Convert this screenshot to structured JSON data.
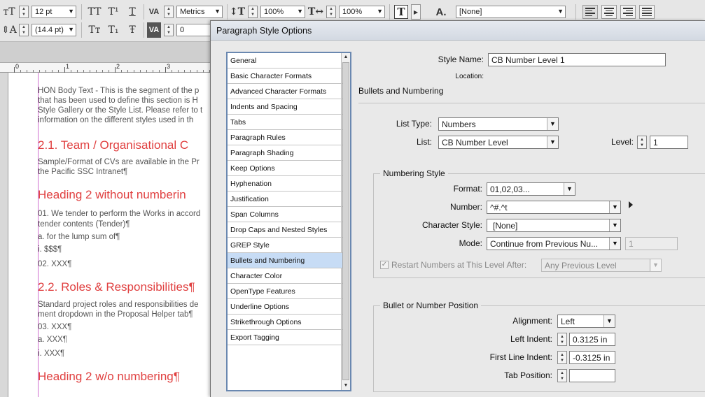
{
  "toolbar": {
    "font_size": "12 pt",
    "leading": "(14.4 pt)",
    "kerning": "Metrics",
    "tracking": "0",
    "vertical_scale": "100%",
    "horizontal_scale": "100%",
    "language": "[None]",
    "icon_all_caps": "TT",
    "icon_superscript": "T¹",
    "icon_underline": "T",
    "icon_small_caps": "Tт",
    "icon_subscript": "T₁",
    "icon_strikethrough": "Ŧ",
    "icon_char_style": "A."
  },
  "ruler": {
    "labels": [
      "0",
      "1",
      "2",
      "3"
    ]
  },
  "document": {
    "lines": [
      {
        "cls": "body-t",
        "text": "HON Body Text - This is the segment of the p"
      },
      {
        "cls": "body-t",
        "text": "that has been used to define this section is H"
      },
      {
        "cls": "body-t",
        "text": "Style Gallery or the Style List. Please refer to t"
      },
      {
        "cls": "body-t",
        "text": "information on the different styles used in th"
      },
      {
        "cls": "h2",
        "text": "2.1. Team / Organisational C"
      },
      {
        "cls": "body-t",
        "text": "Sample/Format of CVs are available in the Pr"
      },
      {
        "cls": "body-t",
        "text": "the Pacific SSC Intranet¶"
      },
      {
        "cls": "h2",
        "text": "Heading 2 without numberin"
      },
      {
        "cls": "body-t",
        "text": "01. We tender to perform the Works in accord"
      },
      {
        "cls": "body-t",
        "text": "      tender contents (Tender)¶"
      },
      {
        "cls": "body-t",
        "text": "         a.    for the lump sum of¶"
      },
      {
        "cls": "body-t",
        "text": "                  i.     $$$¶"
      },
      {
        "cls": "body-t",
        "text": "02. XXX¶"
      },
      {
        "cls": "h2",
        "text": "2.2. Roles & Responsibilities¶"
      },
      {
        "cls": "body-t",
        "text": "Standard project roles and responsibilities de"
      },
      {
        "cls": "body-t",
        "text": "ment dropdown in the Proposal Helper tab¶"
      },
      {
        "cls": "body-t",
        "text": "03. XXX¶"
      },
      {
        "cls": "body-t",
        "text": "         a.    XXX¶"
      },
      {
        "cls": "body-t",
        "text": "                  i.     XXX¶"
      },
      {
        "cls": "h2",
        "text": "Heading 2 w/o numbering¶"
      }
    ]
  },
  "dialog": {
    "title": "Paragraph Style Options",
    "categories": [
      "General",
      "Basic Character Formats",
      "Advanced Character Formats",
      "Indents and Spacing",
      "Tabs",
      "Paragraph Rules",
      "Paragraph Shading",
      "Keep Options",
      "Hyphenation",
      "Justification",
      "Span Columns",
      "Drop Caps and Nested Styles",
      "GREP Style",
      "Bullets and Numbering",
      "Character Color",
      "OpenType Features",
      "Underline Options",
      "Strikethrough Options",
      "Export Tagging"
    ],
    "selected_category": "Bullets and Numbering",
    "style_name_label": "Style Name:",
    "style_name": "CB Number Level 1",
    "location_label": "Location:",
    "section_title": "Bullets and Numbering",
    "list_type_label": "List Type:",
    "list_type": "Numbers",
    "list_label": "List:",
    "list": "CB Number Level",
    "level_label": "Level:",
    "level": "1",
    "numbering_style": {
      "title": "Numbering Style",
      "format_label": "Format:",
      "format": "01,02,03...",
      "number_label": "Number:",
      "number": "^#.^t",
      "char_style_label": "Character Style:",
      "char_style": "[None]",
      "mode_label": "Mode:",
      "mode": "Continue from Previous Nu...",
      "mode_value": "1",
      "restart_label": "Restart Numbers at This Level After:",
      "restart_checked": true,
      "restart_value": "Any Previous Level"
    },
    "position": {
      "title": "Bullet or Number Position",
      "alignment_label": "Alignment:",
      "alignment": "Left",
      "left_indent_label": "Left Indent:",
      "left_indent": "0.3125 in",
      "first_line_label": "First Line Indent:",
      "first_line": "-0.3125 in",
      "tab_position_label": "Tab Position:",
      "tab_position": ""
    }
  }
}
